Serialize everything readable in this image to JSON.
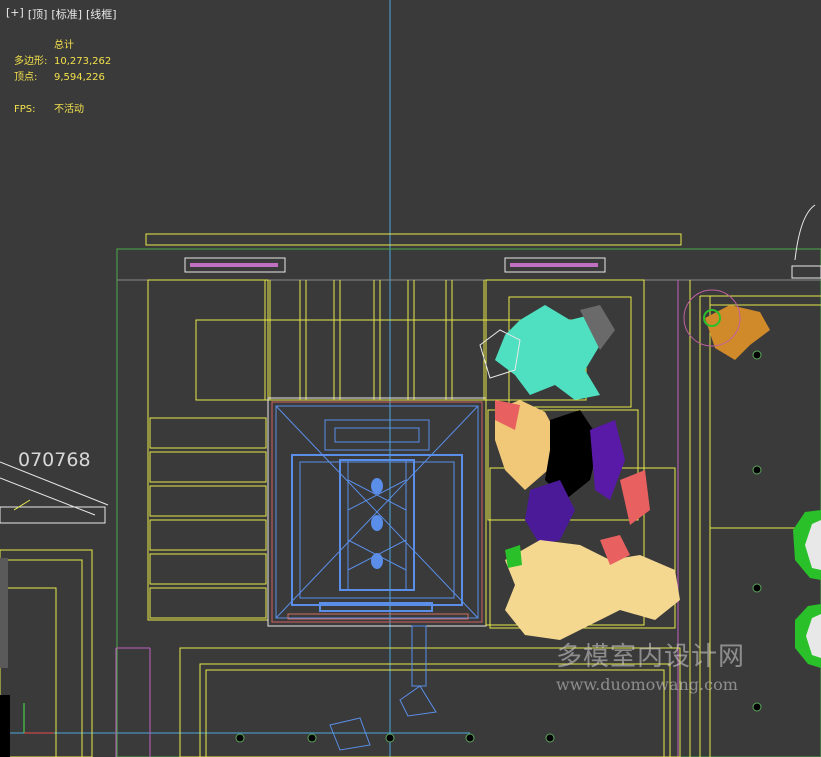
{
  "viewport_label": {
    "plus": "[+]",
    "view": "[顶]",
    "shading": "[标准]",
    "style": "[线框]"
  },
  "stats": {
    "title": "总计",
    "polygons_label": "多边形:",
    "polygons_value": "10,273,262",
    "vertices_label": "顶点:",
    "vertices_value": "9,594,226",
    "fps_label": "FPS:",
    "fps_value": "不活动"
  },
  "scene_label": "070768",
  "watermark": {
    "title": "多模室内设计网",
    "url": "www.duomowang.com"
  },
  "colors": {
    "background": "#3a3a3a",
    "stats_text": "#f2e04a",
    "axis_line": "#4aa8d8",
    "wire_yellow": "#e8e84a",
    "wire_blue": "#5a8ee8",
    "plant_cyan": "#4ee0c0",
    "plant_cream": "#f5d890",
    "plant_purple": "#5a1aa8",
    "plant_red": "#e86060",
    "plant_green": "#2ac02a",
    "plant_orange": "#d08a2a"
  }
}
